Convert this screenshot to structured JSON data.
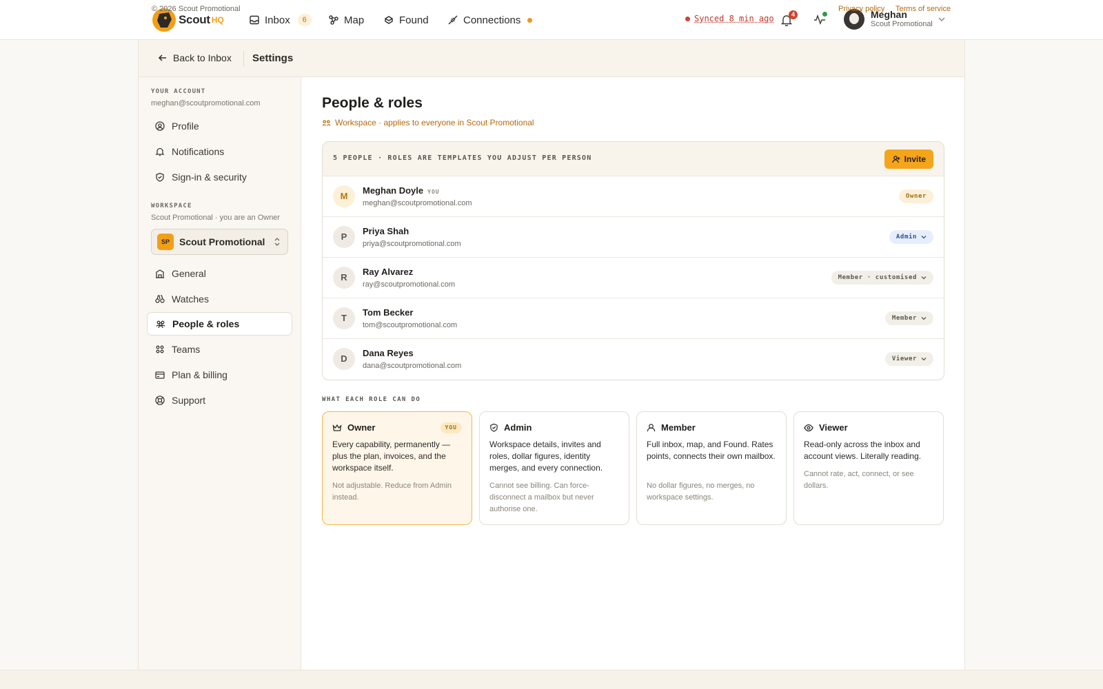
{
  "brand": {
    "name": "Scout",
    "suffix": "HQ"
  },
  "nav": {
    "inbox": {
      "label": "Inbox",
      "badge": "6"
    },
    "map": {
      "label": "Map"
    },
    "found": {
      "label": "Found"
    },
    "connections": {
      "label": "Connections"
    }
  },
  "status": {
    "sync": "Synced 8 min ago",
    "notifications": "4"
  },
  "user": {
    "name": "Meghan",
    "org": "Scout Promotional"
  },
  "subbar": {
    "back": "Back to Inbox",
    "title": "Settings"
  },
  "sidebar": {
    "account_label": "YOUR ACCOUNT",
    "account_email": "meghan@scoutpromotional.com",
    "account_items": [
      "Profile",
      "Notifications",
      "Sign-in & security"
    ],
    "workspace_label": "WORKSPACE",
    "workspace_sub": "Scout Promotional · you are an Owner",
    "workspace_badge": "SP",
    "workspace_name": "Scout Promotional",
    "workspace_items": [
      "General",
      "Watches",
      "People & roles",
      "Teams",
      "Plan & billing",
      "Support"
    ]
  },
  "main": {
    "title": "People & roles",
    "scope": "Workspace · applies to everyone in Scout Promotional",
    "people_header": "5 PEOPLE · ROLES ARE TEMPLATES YOU ADJUST PER PERSON",
    "invite": "Invite",
    "you_tag": "YOU",
    "people": [
      {
        "initial": "M",
        "name": "Meghan Doyle",
        "email": "meghan@scoutpromotional.com",
        "role": "Owner"
      },
      {
        "initial": "P",
        "name": "Priya Shah",
        "email": "priya@scoutpromotional.com",
        "role": "Admin"
      },
      {
        "initial": "R",
        "name": "Ray Alvarez",
        "email": "ray@scoutpromotional.com",
        "role": "Member · customised"
      },
      {
        "initial": "T",
        "name": "Tom Becker",
        "email": "tom@scoutpromotional.com",
        "role": "Member"
      },
      {
        "initial": "D",
        "name": "Dana Reyes",
        "email": "dana@scoutpromotional.com",
        "role": "Viewer"
      }
    ],
    "roles_label": "WHAT EACH ROLE CAN DO",
    "roles": [
      {
        "name": "Owner",
        "tag": "YOU",
        "desc": "Every capability, permanently — plus the plan, invoices, and the workspace itself.",
        "note": "Not adjustable. Reduce from Admin instead."
      },
      {
        "name": "Admin",
        "desc": "Workspace details, invites and roles, dollar figures, identity merges, and every connection.",
        "note": "Cannot see billing. Can force-disconnect a mailbox but never authorise one."
      },
      {
        "name": "Member",
        "desc": "Full inbox, map, and Found. Rates points, connects their own mailbox.",
        "note": "No dollar figures, no merges, no workspace settings."
      },
      {
        "name": "Viewer",
        "desc": "Read-only across the inbox and account views. Literally reading.",
        "note": "Cannot rate, act, connect, or see dollars."
      }
    ]
  },
  "footer": {
    "copyright": "© 2026 Scout Promotional",
    "privacy": "Privacy policy",
    "terms": "Terms of service"
  },
  "colors": {
    "accent": "#f4a51c",
    "brand": "#f29f18",
    "sync_error": "#d5412e",
    "link": "#b4690e"
  }
}
